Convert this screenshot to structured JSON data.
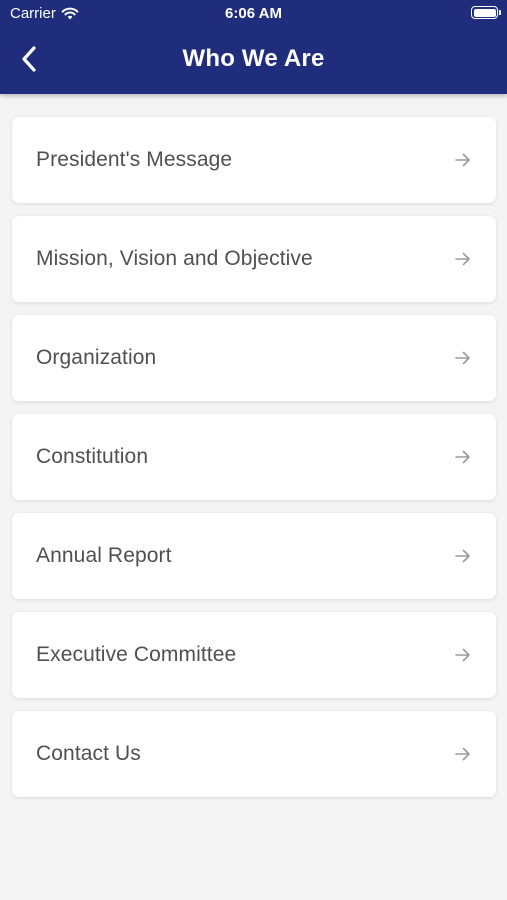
{
  "status_bar": {
    "carrier": "Carrier",
    "time": "6:06 AM",
    "wifi_icon": "wifi-icon",
    "battery_icon": "battery-full-icon"
  },
  "header": {
    "title": "Who We Are",
    "back_icon": "chevron-left-icon",
    "background_color": "#1f2d7c"
  },
  "menu": {
    "items": [
      {
        "label": "President's Message",
        "icon": "arrow-right-icon"
      },
      {
        "label": "Mission, Vision and Objective",
        "icon": "arrow-right-icon"
      },
      {
        "label": "Organization",
        "icon": "arrow-right-icon"
      },
      {
        "label": "Constitution",
        "icon": "arrow-right-icon"
      },
      {
        "label": "Annual Report",
        "icon": "arrow-right-icon"
      },
      {
        "label": "Executive Committee",
        "icon": "arrow-right-icon"
      },
      {
        "label": "Contact Us",
        "icon": "arrow-right-icon"
      }
    ]
  }
}
